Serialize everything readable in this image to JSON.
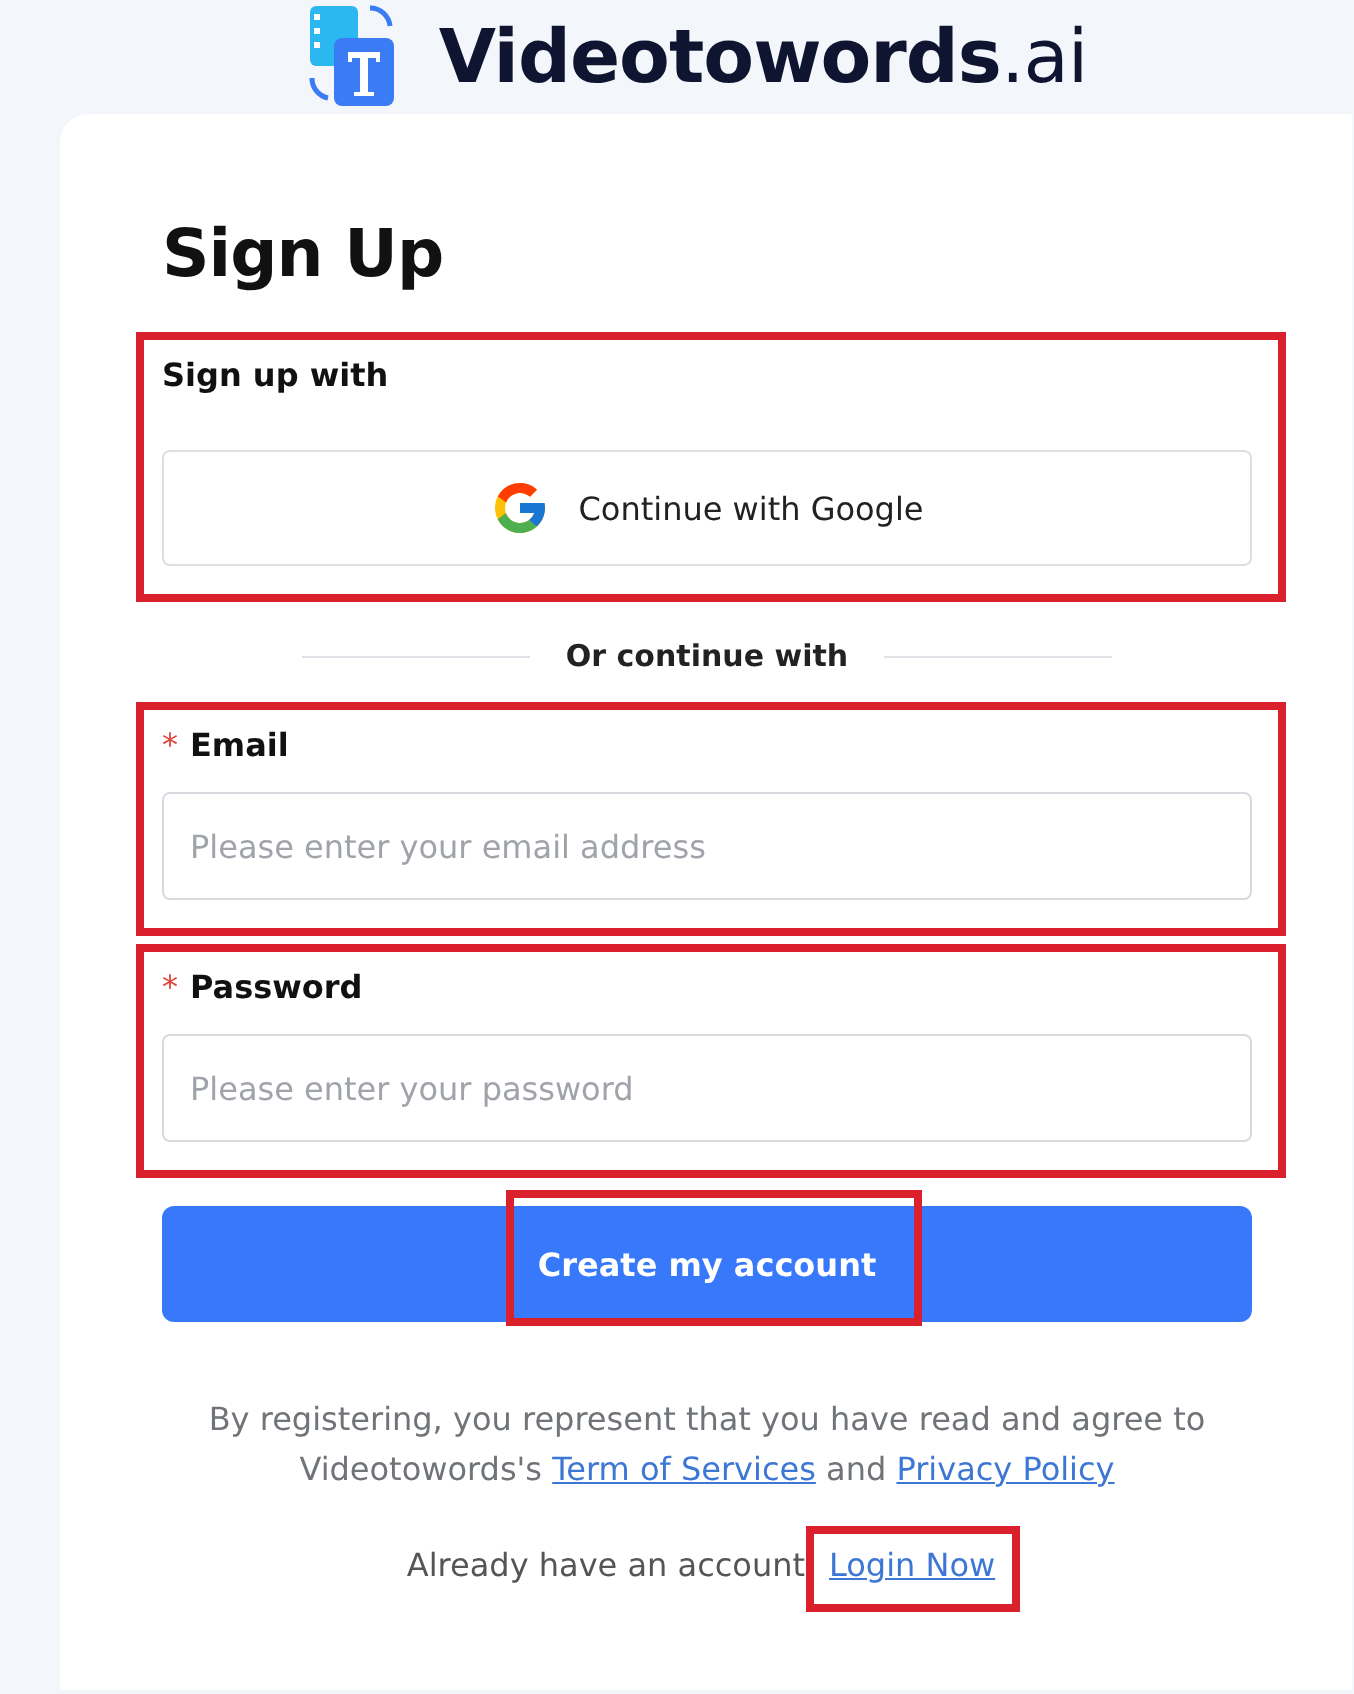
{
  "brand": {
    "name": "Videotowords",
    "suffix": ".ai"
  },
  "title": "Sign Up",
  "social": {
    "heading": "Sign up with",
    "button": "Continue with Google",
    "highlighted": true
  },
  "divider": "Or continue with",
  "fields": [
    {
      "label": "Email",
      "required_mark": "*",
      "placeholder": "Please enter your email address",
      "highlighted": true
    },
    {
      "label": "Password",
      "required_mark": "*",
      "placeholder": "Please enter your password",
      "highlighted": true
    }
  ],
  "submit": {
    "label": "Create my account",
    "highlighted": true
  },
  "terms": {
    "text": "By registering, you represent that you have read and agree to Videotowords's",
    "links": [
      "Term of Services",
      "Privacy Policy"
    ],
    "joiner": "and"
  },
  "login": {
    "prompt": "Already have an account",
    "link": "Login Now",
    "highlighted": true
  }
}
